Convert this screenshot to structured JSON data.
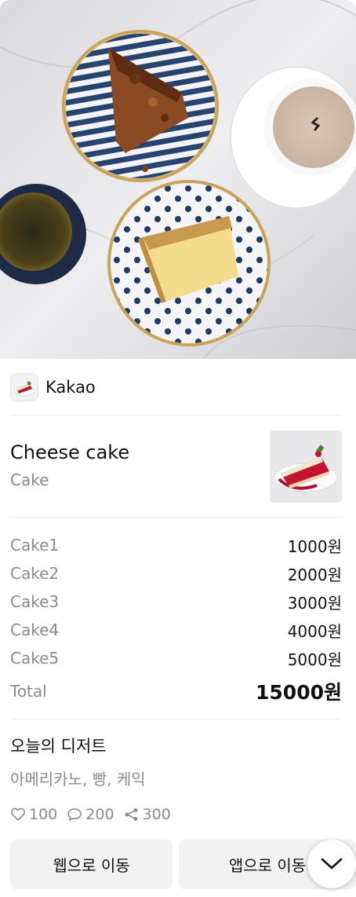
{
  "profile": {
    "name": "Kakao"
  },
  "item": {
    "title": "Cheese cake",
    "subtitle": "Cake"
  },
  "items": [
    {
      "name": "Cake1",
      "price": "1000원"
    },
    {
      "name": "Cake2",
      "price": "2000원"
    },
    {
      "name": "Cake3",
      "price": "3000원"
    },
    {
      "name": "Cake4",
      "price": "4000원"
    },
    {
      "name": "Cake5",
      "price": "5000원"
    }
  ],
  "total": {
    "label": "Total",
    "price": "15000원"
  },
  "description": {
    "title": "오늘의 디저트",
    "text": "아메리카노, 빵, 케익"
  },
  "social": {
    "likes": "100",
    "comments": "200",
    "shares": "300"
  },
  "buttons": {
    "web": "웹으로 이동",
    "app": "앱으로 이동"
  },
  "icons": [
    "heart-icon",
    "comment-icon",
    "share-icon",
    "chevron-down-icon"
  ]
}
